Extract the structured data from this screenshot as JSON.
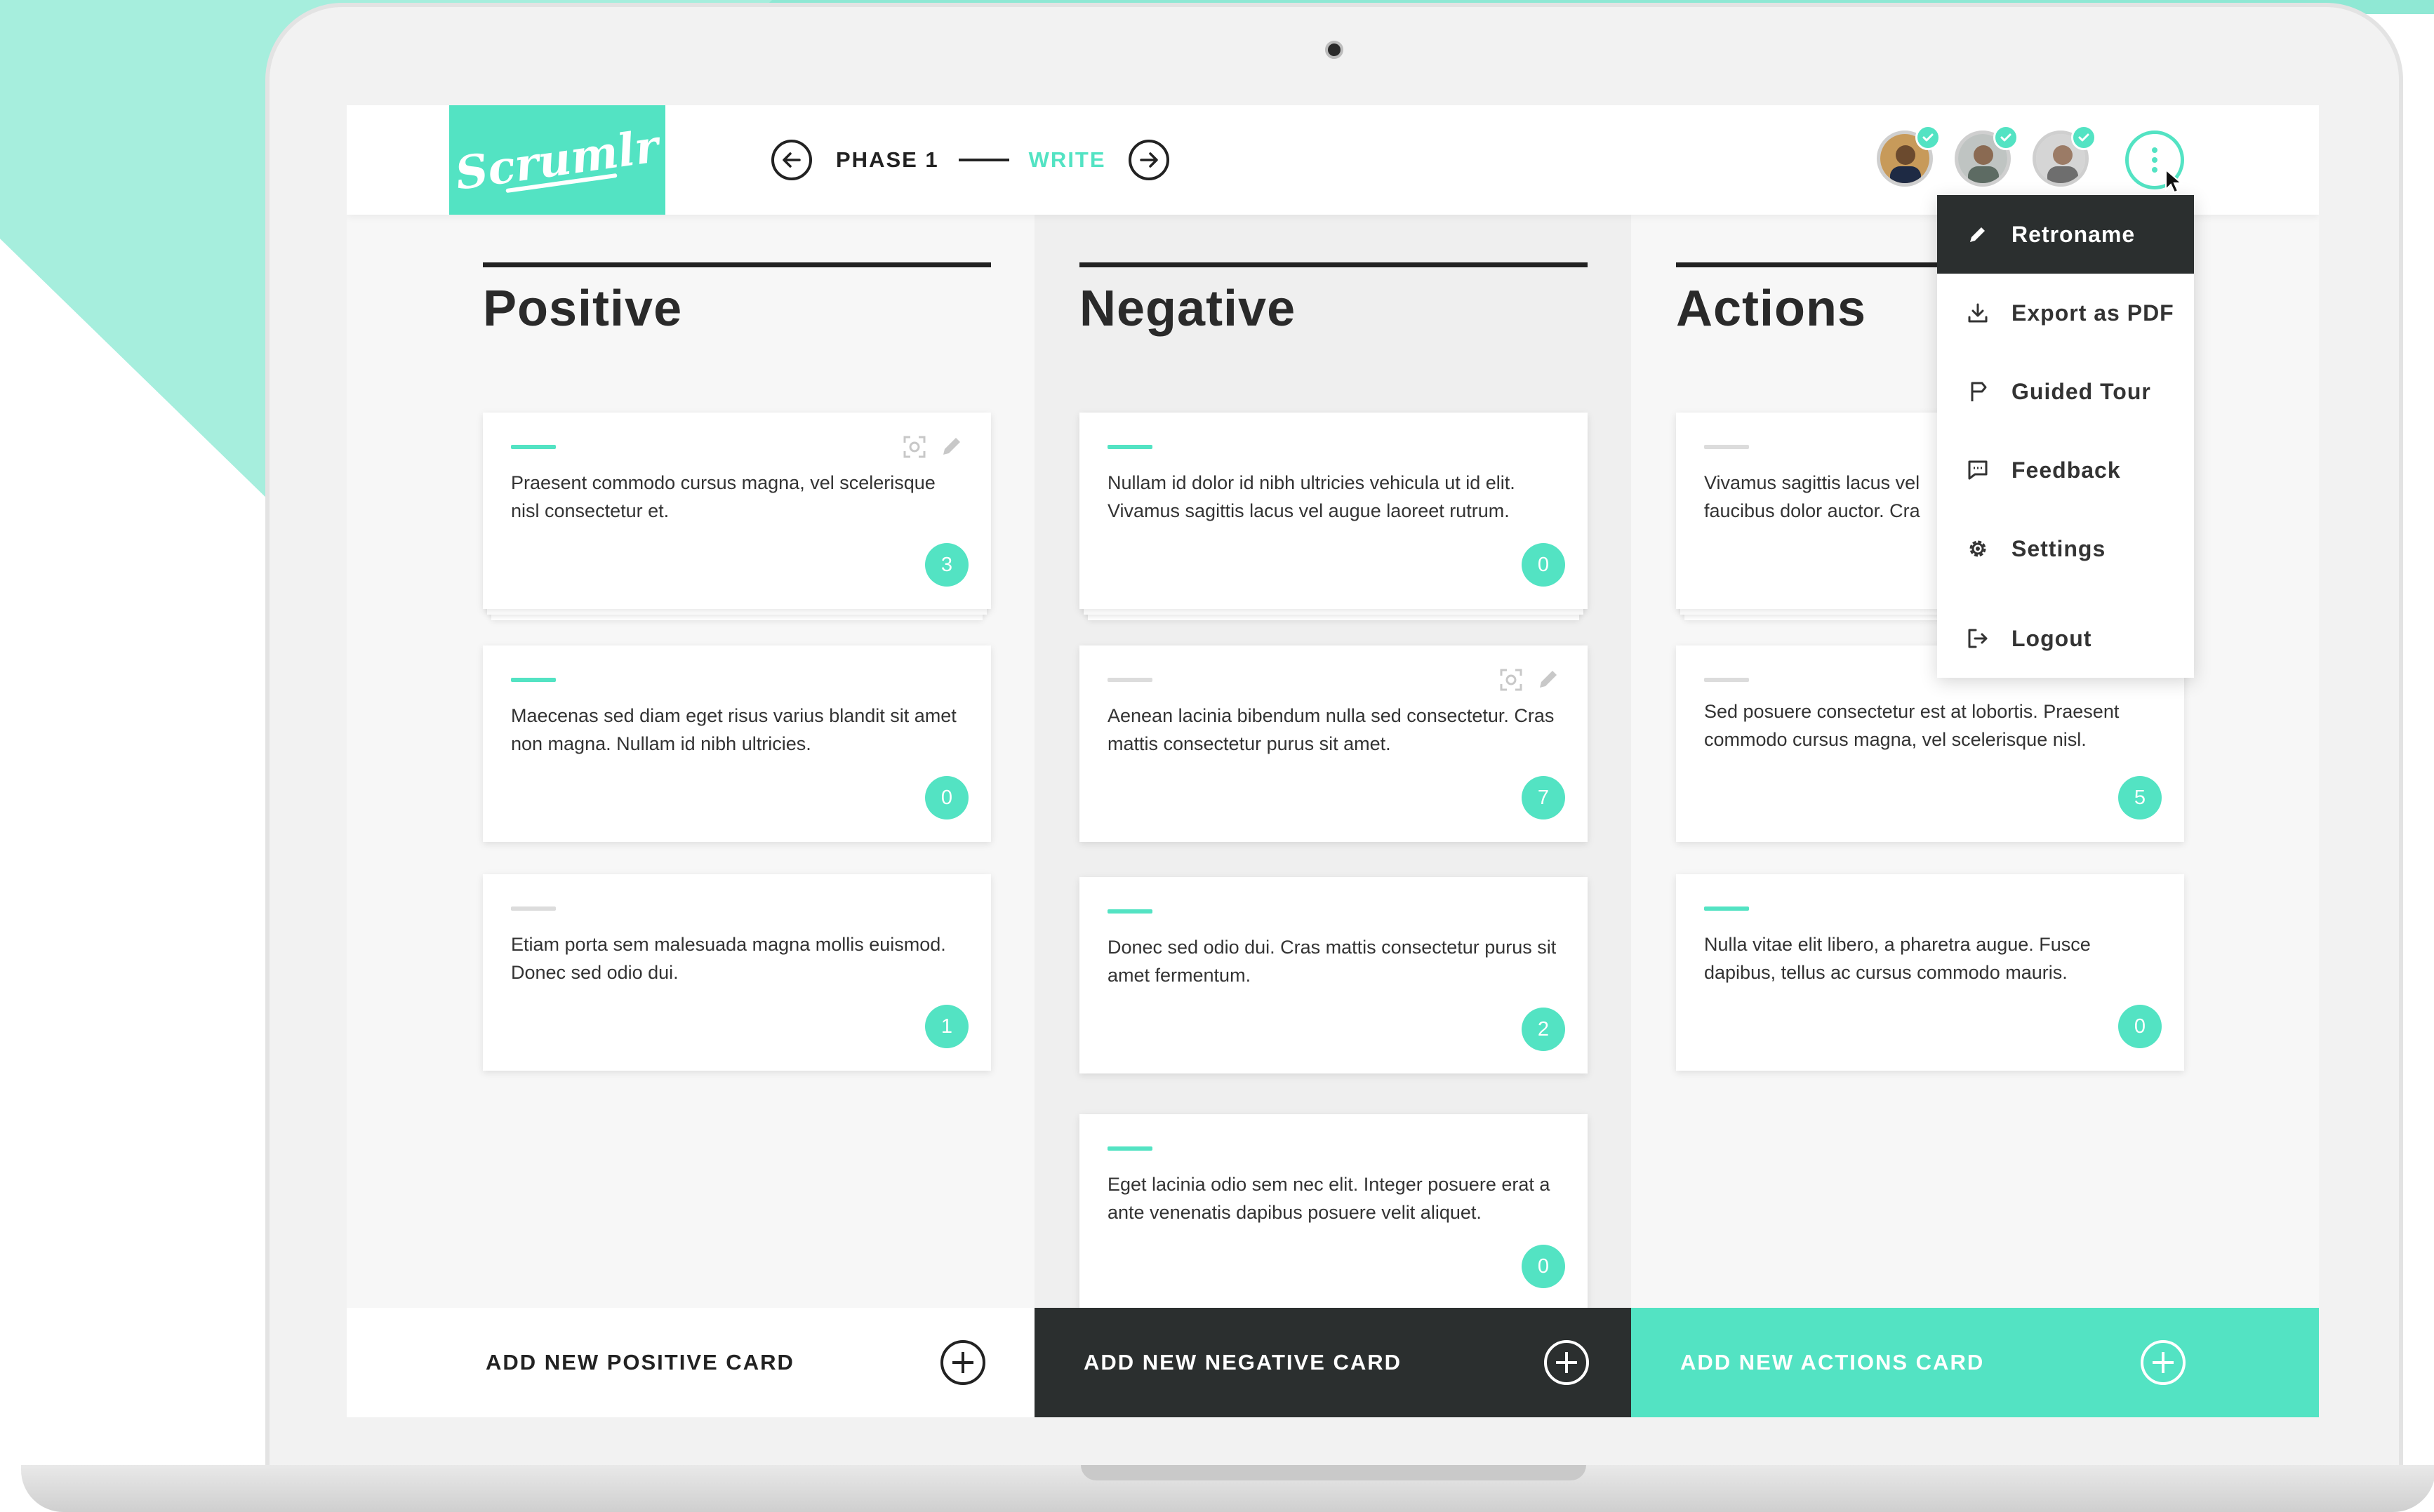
{
  "app": {
    "logo_text": "Scrumlr"
  },
  "phase": {
    "label": "PHASE 1",
    "step": "WRITE"
  },
  "menu": {
    "items": [
      {
        "label": "Retroname",
        "icon": "pencil-icon",
        "active": true
      },
      {
        "label": "Export as PDF",
        "icon": "download-icon",
        "active": false
      },
      {
        "label": "Guided Tour",
        "icon": "signpost-icon",
        "active": false
      },
      {
        "label": "Feedback",
        "icon": "chat-icon",
        "active": false
      },
      {
        "label": "Settings",
        "icon": "gear-icon",
        "active": false
      },
      {
        "label": "Logout",
        "icon": "logout-icon",
        "active": false
      }
    ]
  },
  "columns": {
    "positive": {
      "title": "Positive",
      "cards": [
        {
          "text": "Praesent commodo cursus magna, vel scelerisque nisl consectetur et.",
          "votes": "3"
        },
        {
          "text": "Maecenas sed diam eget risus varius blandit sit amet non magna. Nullam id nibh ultricies.",
          "votes": "0"
        },
        {
          "text": "Etiam porta sem malesuada magna mollis euismod. Donec sed odio dui.",
          "votes": "1"
        }
      ],
      "add_label": "ADD NEW POSITIVE CARD"
    },
    "negative": {
      "title": "Negative",
      "cards": [
        {
          "text": "Nullam id dolor id nibh ultricies vehicula ut id elit. Vivamus sagittis lacus vel augue laoreet rutrum.",
          "votes": "0"
        },
        {
          "text": "Aenean lacinia bibendum nulla sed consectetur. Cras mattis consectetur purus sit amet.",
          "votes": "7"
        },
        {
          "text": "Donec sed odio dui. Cras mattis consectetur purus sit amet fermentum.",
          "votes": "2"
        },
        {
          "text": "Eget lacinia odio sem nec elit. Integer posuere erat a ante venenatis dapibus posuere velit aliquet.",
          "votes": "0"
        }
      ],
      "add_label": "ADD NEW NEGATIVE CARD"
    },
    "actions": {
      "title": "Actions",
      "cards": [
        {
          "text": "Vivamus sagittis lacus vel faucibus dolor auctor. Cra",
          "votes": ""
        },
        {
          "text": "Sed posuere consectetur est at lobortis. Praesent commodo cursus magna, vel scelerisque nisl.",
          "votes": "5"
        },
        {
          "text": "Nulla vitae elit libero, a pharetra augue. Fusce dapibus, tellus ac cursus commodo mauris.",
          "votes": "0"
        }
      ],
      "add_label": "ADD NEW ACTIONS CARD"
    }
  },
  "colors": {
    "accent": "#53e3c3",
    "dark": "#2b2f2f",
    "background_shape": "#8fe8d4"
  }
}
